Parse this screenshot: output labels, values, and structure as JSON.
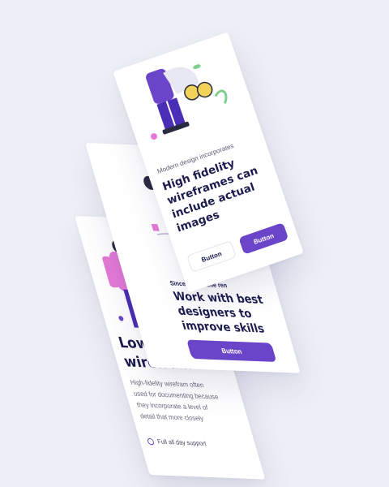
{
  "screen_front": {
    "subtitle": "Modern design incorporates",
    "heading": "High fidelity wireframes can include actual images",
    "button_outline": "Button",
    "button_primary": "Button"
  },
  "screen_middle": {
    "subtitle": "Since wire-frame ren",
    "heading": "Work with best designers to improve skills",
    "button_primary": "Button"
  },
  "screen_back": {
    "heading": "Low fidelity wirefram",
    "body": "High-fidelity wirefram often used for documenting because they incorporate a level of detail that more closely",
    "feature": "Full all day support"
  },
  "colors": {
    "accent": "#6a45c9",
    "heading": "#1c1c4f",
    "background": "#eef0f7"
  }
}
